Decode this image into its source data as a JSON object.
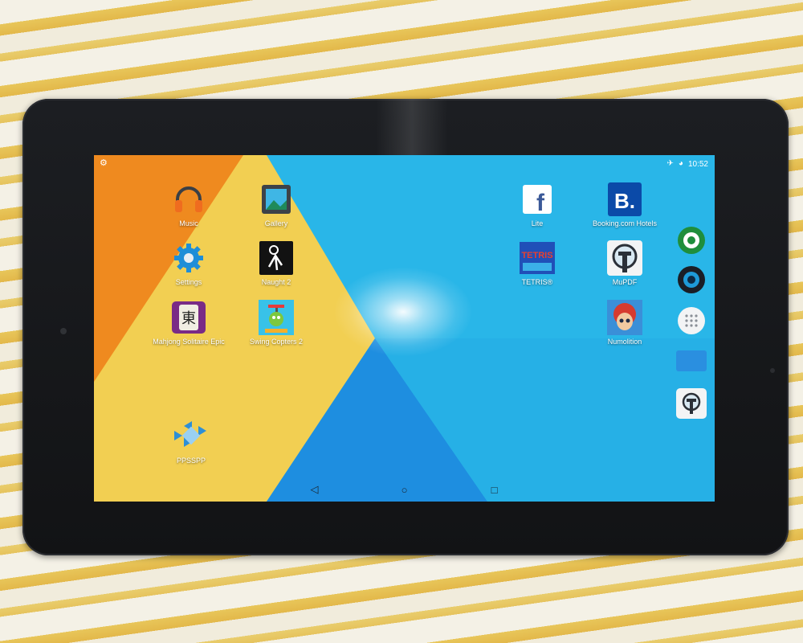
{
  "status_bar": {
    "time": "10:52",
    "airplane_icon": "airplane-icon",
    "battery_icon": "battery-icon"
  },
  "home_apps_left": [
    {
      "label": "Music",
      "icon": "headphones-icon"
    },
    {
      "label": "Gallery",
      "icon": "picture-icon"
    },
    {
      "label": "Settings",
      "icon": "gear-icon"
    },
    {
      "label": "Naught 2",
      "icon": "naught-icon"
    },
    {
      "label": "Mahjong Solitaire Epic",
      "icon": "mahjong-tile-icon"
    },
    {
      "label": "Swing Copters 2",
      "icon": "copter-icon"
    },
    {
      "label": "PPSSPP",
      "icon": "gamepad-icon"
    }
  ],
  "home_apps_right": [
    {
      "label": "Lite",
      "icon": "facebook-icon"
    },
    {
      "label": "Booking.com Hotels",
      "icon": "booking-icon"
    },
    {
      "label": "TETRIS®",
      "icon": "tetris-icon"
    },
    {
      "label": "MuPDF",
      "icon": "mupdf-icon"
    },
    {
      "label": "Numolition",
      "icon": "numolition-icon"
    }
  ],
  "tetris_logo_text": "TETRIS",
  "facebook_glyph": "f",
  "booking_glyph": "B.",
  "mahjong_glyph": "東",
  "dock": [
    "chrome-like-icon",
    "camera-icon",
    "app-drawer-icon",
    "email-icon",
    "mupdf-icon"
  ],
  "navbar": {
    "back": "◁",
    "home": "○",
    "recents": "□"
  },
  "colors": {
    "wallpaper_blue": "#29b6e8",
    "wallpaper_yellow": "#f2cf52",
    "wallpaper_orange": "#ef8a1f",
    "wallpaper_dark_blue": "#1e8ee0"
  }
}
